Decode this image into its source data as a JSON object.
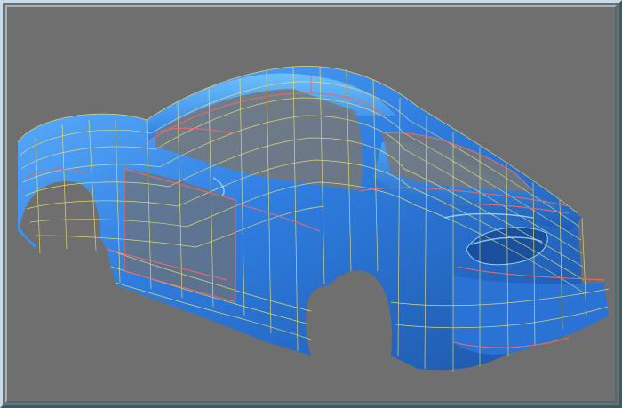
{
  "viewport": {
    "background": "#6f6f6f",
    "frame_highlight": "#c8dce8",
    "frame_shadow": "#3c5a66"
  },
  "model": {
    "surface_color": "#2f7de0",
    "surface_highlight": "#5fb2ff",
    "surface_dark": "#1c56a8",
    "wire_primary": "#e8e070",
    "wire_secondary": "#e86a6a",
    "icon": "car-body-wireframe-icon"
  }
}
